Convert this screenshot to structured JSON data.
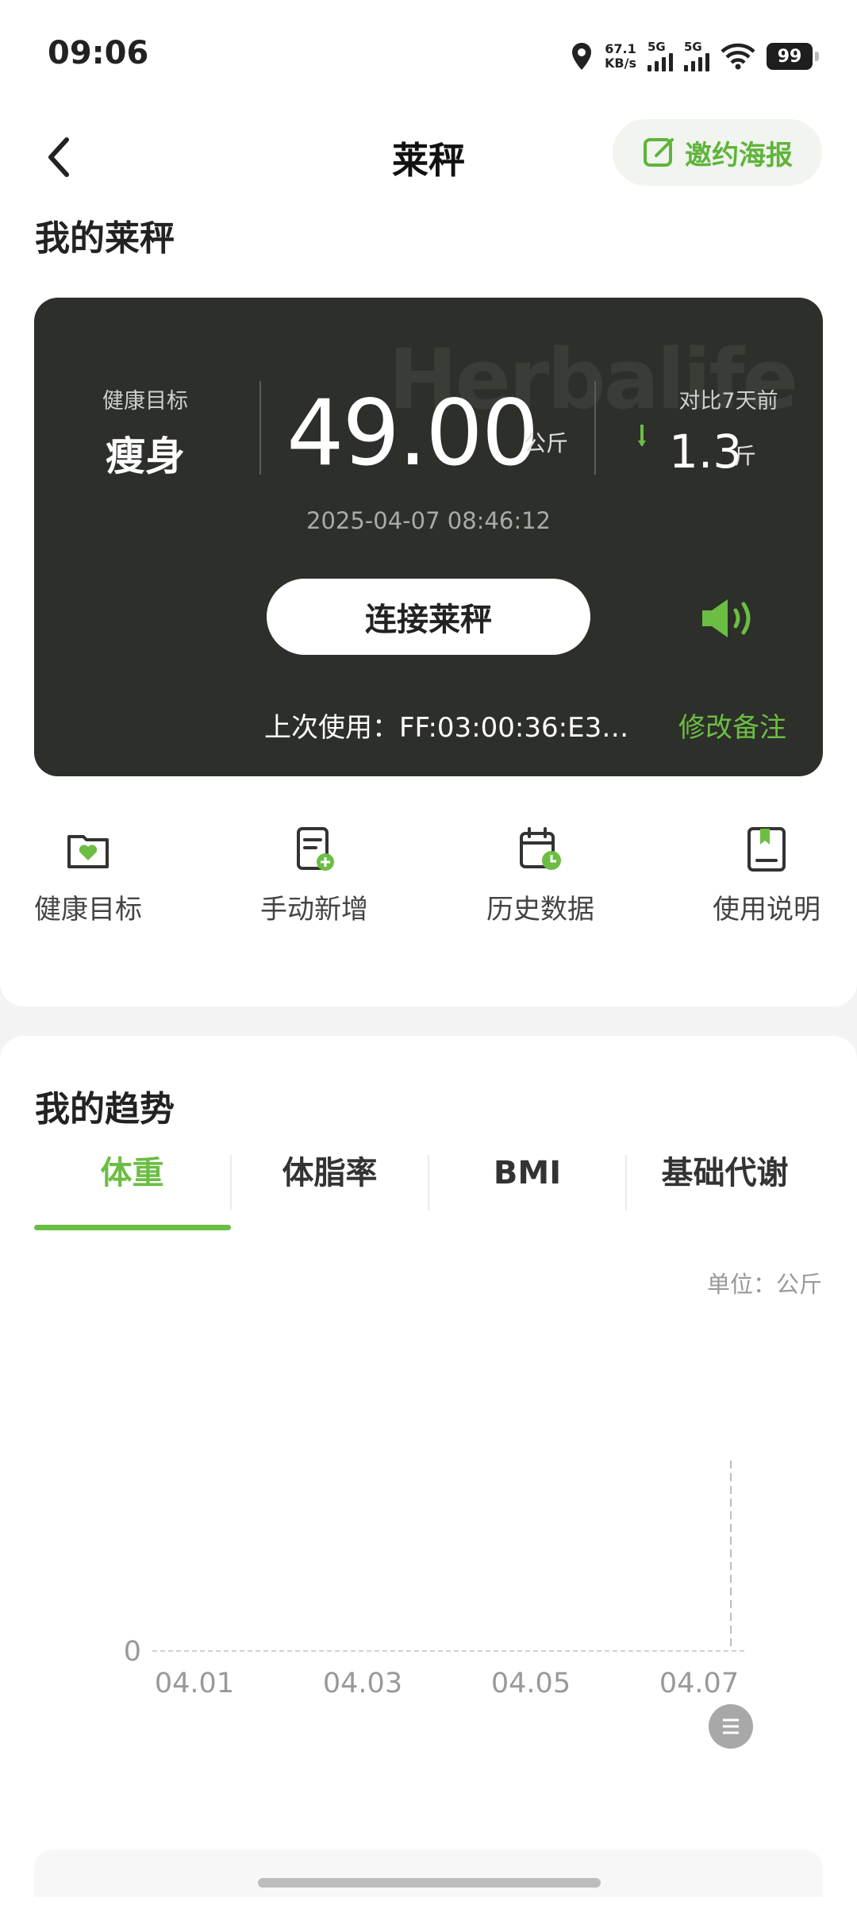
{
  "status": {
    "time": "09:06",
    "net_speed_value": "67.1",
    "net_speed_unit": "KB/s",
    "signal1": "5G",
    "signal2": "5G",
    "battery": "99"
  },
  "header": {
    "title": "莱秤",
    "invite_label": "邀约海报"
  },
  "my_scale": {
    "section_title": "我的莱秤",
    "watermark": "Herbalife",
    "goal_label": "健康目标",
    "goal_value": "瘦身",
    "weight": "49.00",
    "weight_unit": "公斤",
    "compare_label": "对比7天前",
    "compare_value": "1.3",
    "compare_unit": "斤",
    "compare_direction": "down",
    "datetime": "2025-04-07 08:46:12",
    "connect_label": "连接莱秤",
    "last_use": "上次使用：FF:03:00:36:E3:...",
    "edit_note": "修改备注"
  },
  "quick_actions": [
    {
      "label": "健康目标",
      "icon": "heart-folder-icon"
    },
    {
      "label": "手动新增",
      "icon": "add-note-icon"
    },
    {
      "label": "历史数据",
      "icon": "calendar-clock-icon"
    },
    {
      "label": "使用说明",
      "icon": "bookmark-book-icon"
    }
  ],
  "trends": {
    "section_title": "我的趋势",
    "tabs": [
      "体重",
      "体脂率",
      "BMI",
      "基础代谢"
    ],
    "active_tab": 0,
    "unit_label": "单位：公斤"
  },
  "colors": {
    "accent": "#6cbd44",
    "dark_card": "#2d2f2a"
  },
  "chart_data": {
    "type": "line",
    "x_ticks": [
      "04.01",
      "04.03",
      "04.05",
      "04.07"
    ],
    "y_ticks": [
      "0"
    ],
    "series": [],
    "highlight_x": "04.07",
    "grid": false
  }
}
